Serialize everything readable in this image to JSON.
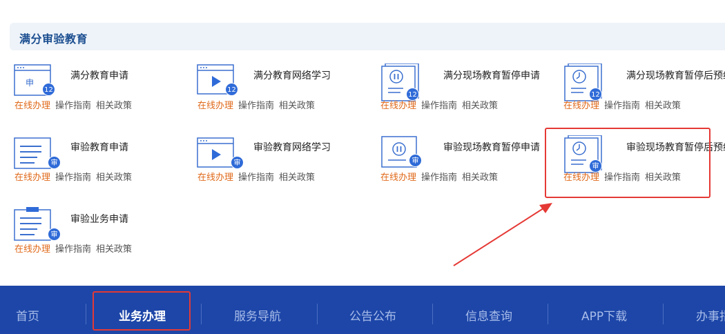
{
  "section": {
    "title": "满分审验教育"
  },
  "items": [
    {
      "title": "满分教育申请",
      "badge": "12",
      "icon": "application-form-icon",
      "online": "在线办理",
      "guide": "操作指南",
      "policy": "相关政策"
    },
    {
      "title": "满分教育网络学习",
      "badge": "12",
      "icon": "video-play-icon",
      "online": "在线办理",
      "guide": "操作指南",
      "policy": "相关政策"
    },
    {
      "title": "满分现场教育暂停申请",
      "badge": "12",
      "icon": "pause-document-icon",
      "online": "在线办理",
      "guide": "操作指南",
      "policy": "相关政策"
    },
    {
      "title": "满分现场教育暂停后预约",
      "badge": "12",
      "icon": "clock-document-icon",
      "online": "在线办理",
      "guide": "操作指南",
      "policy": "相关政策"
    },
    {
      "title": "审验教育申请",
      "badge": "审",
      "icon": "document-list-icon",
      "online": "在线办理",
      "guide": "操作指南",
      "policy": "相关政策"
    },
    {
      "title": "审验教育网络学习",
      "badge": "审",
      "icon": "video-play-icon",
      "online": "在线办理",
      "guide": "操作指南",
      "policy": "相关政策"
    },
    {
      "title": "审验现场教育暂停申请",
      "badge": "审",
      "icon": "pause-document-icon",
      "online": "在线办理",
      "guide": "操作指南",
      "policy": "相关政策"
    },
    {
      "title": "审验现场教育暂停后预约",
      "badge": "审",
      "icon": "clock-document-icon",
      "online": "在线办理",
      "guide": "操作指南",
      "policy": "相关政策"
    },
    {
      "title": "审验业务申请",
      "badge": "审",
      "icon": "clipboard-icon",
      "online": "在线办理",
      "guide": "操作指南",
      "policy": "相关政策"
    }
  ],
  "nav": {
    "items": [
      "首页",
      "业务办理",
      "服务导航",
      "公告公布",
      "信息查询",
      "APP下载",
      "办事指"
    ],
    "active": "业务办理"
  },
  "colors": {
    "nav_bg": "#1d46a8",
    "accent_orange": "#e06a1b",
    "badge_blue": "#2f6bd8",
    "annotation_red": "#e53935"
  }
}
